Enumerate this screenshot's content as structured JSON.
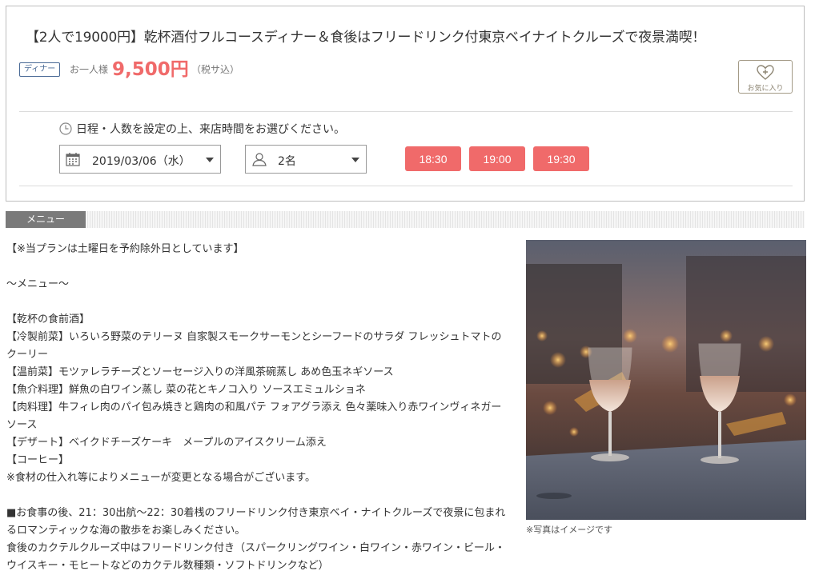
{
  "plan": {
    "title": "【2人で19000円】乾杯酒付フルコースディナー＆食後はフリードリンク付東京ベイナイトクルーズで夜景満喫！",
    "category_tag": "ディナー",
    "price_prefix": "お一人様",
    "price": "9,500円",
    "tax_note": "（税サ込）",
    "favorite_label": "お気に入り",
    "favorite_icon": "heart-plus-icon"
  },
  "booking": {
    "instruction": "日程・人数を設定の上、来店時間をお選びください。",
    "instruction_icon": "clock-icon",
    "date_value": "2019/03/06（水）",
    "date_icon": "calendar-icon",
    "people_value": "2名",
    "people_icon": "person-icon",
    "times": [
      "18:30",
      "19:00",
      "19:30"
    ]
  },
  "section": {
    "tab_label": "メニュー"
  },
  "menu": {
    "lines": [
      "【※当プランは土曜日を予約除外日としています】",
      "",
      "～メニュー～",
      "",
      "【乾杯の食前酒】",
      "【冷製前菜】いろいろ野菜のテリーヌ 自家製スモークサーモンとシーフードのサラダ フレッシュトマトの",
      "クーリー",
      "【温前菜】モツァレラチーズとソーセージ入りの洋風茶碗蒸し あめ色玉ネギソース",
      "【魚介料理】鮮魚の白ワイン蒸し 菜の花とキノコ入り ソースエミュルショネ",
      "【肉料理】牛フィレ肉のパイ包み焼きと鶏肉の和風パテ フォアグラ添え 色々薬味入り赤ワインヴィネガー",
      "ソース",
      "【デザート】ベイクドチーズケーキ　メープルのアイスクリーム添え",
      "【コーヒー】",
      "※食材の仕入れ等によりメニューが変更となる場合がございます。",
      "",
      "■お食事の後、21：30出航～22：30着桟のフリードリンク付き東京ベイ・ナイトクルーズで夜景に包まれ",
      "るロマンティックな海の散歩をお楽しみください。",
      "食後のカクテルクルーズ中はフリードリンク付き（スパークリングワイン・白ワイン・赤ワイン・ビール・",
      "ウイスキー・モヒートなどのカクテル数種類・ソフトドリンクなど）"
    ]
  },
  "photo": {
    "caption": "※写真はイメージです"
  },
  "colors": {
    "accent": "#f06a6a",
    "tag_blue": "#4a6a96",
    "section_gray": "#7a7a7a",
    "fav_border": "#a39a86"
  }
}
